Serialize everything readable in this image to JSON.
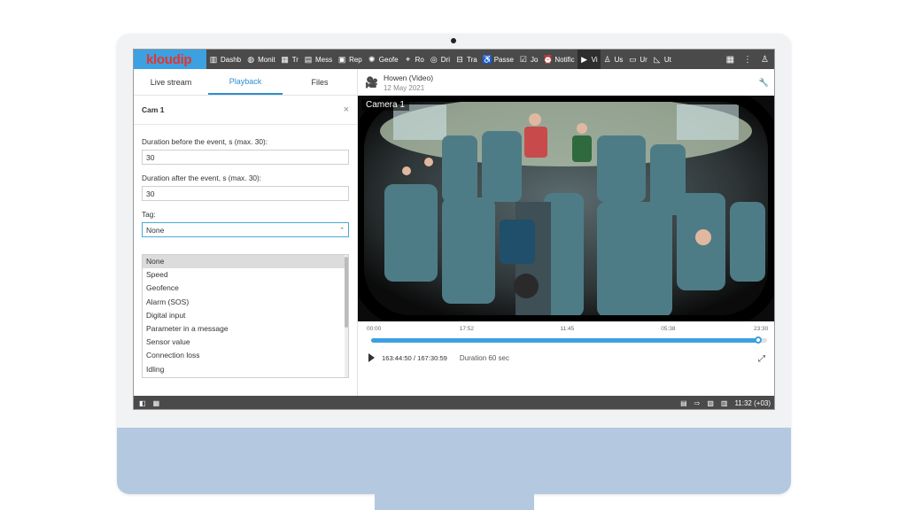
{
  "app": {
    "logo_main": "kloud",
    "logo_accent": "ip"
  },
  "nav": [
    {
      "icon": "bar-chart-icon",
      "label": "Dashb"
    },
    {
      "icon": "globe-icon",
      "label": "Monit"
    },
    {
      "icon": "grid-icon",
      "label": "Tr"
    },
    {
      "icon": "message-icon",
      "label": "Mess"
    },
    {
      "icon": "report-icon",
      "label": "Rep"
    },
    {
      "icon": "geofence-icon",
      "label": "Geofe"
    },
    {
      "icon": "route-icon",
      "label": "Ro"
    },
    {
      "icon": "driver-icon",
      "label": "Dri"
    },
    {
      "icon": "trailer-icon",
      "label": "Tra"
    },
    {
      "icon": "passenger-icon",
      "label": "Passe"
    },
    {
      "icon": "job-icon",
      "label": "Jo"
    },
    {
      "icon": "alarm-clock-icon",
      "label": "Notific"
    },
    {
      "icon": "video-icon",
      "label": "Vi"
    },
    {
      "icon": "user-icon",
      "label": "Us"
    },
    {
      "icon": "bus-icon",
      "label": "Ur"
    },
    {
      "icon": "ruler-icon",
      "label": "Ut"
    }
  ],
  "tabs": [
    "Live stream",
    "Playback",
    "Files"
  ],
  "active_tab": 1,
  "panel": {
    "camera": "Cam 1",
    "before_label": "Duration before the event, s (max. 30):",
    "before_value": "30",
    "after_label": "Duration after the event, s (max. 30):",
    "after_value": "30",
    "tag_label": "Tag:",
    "tag_value": "None",
    "tag_options": [
      "None",
      "Speed",
      "Geofence",
      "Alarm (SOS)",
      "Digital input",
      "Parameter in a message",
      "Sensor value",
      "Connection loss",
      "Idling"
    ]
  },
  "player": {
    "unit": "Howen (Video)",
    "date": "12 May 2021",
    "camera_label": "Camera 1",
    "ticks": [
      "00:00",
      "17:52",
      "11:45",
      "05:38",
      "23:30"
    ],
    "position": "163:44:50 / 167:30:59",
    "duration": "Duration 60 sec",
    "progress": 0.977
  },
  "statusbar": {
    "time": "11:32 (+03)"
  },
  "colors": {
    "accent": "#3da0e0",
    "logo_red": "#e8332a",
    "bar": "#4a4a4a"
  }
}
